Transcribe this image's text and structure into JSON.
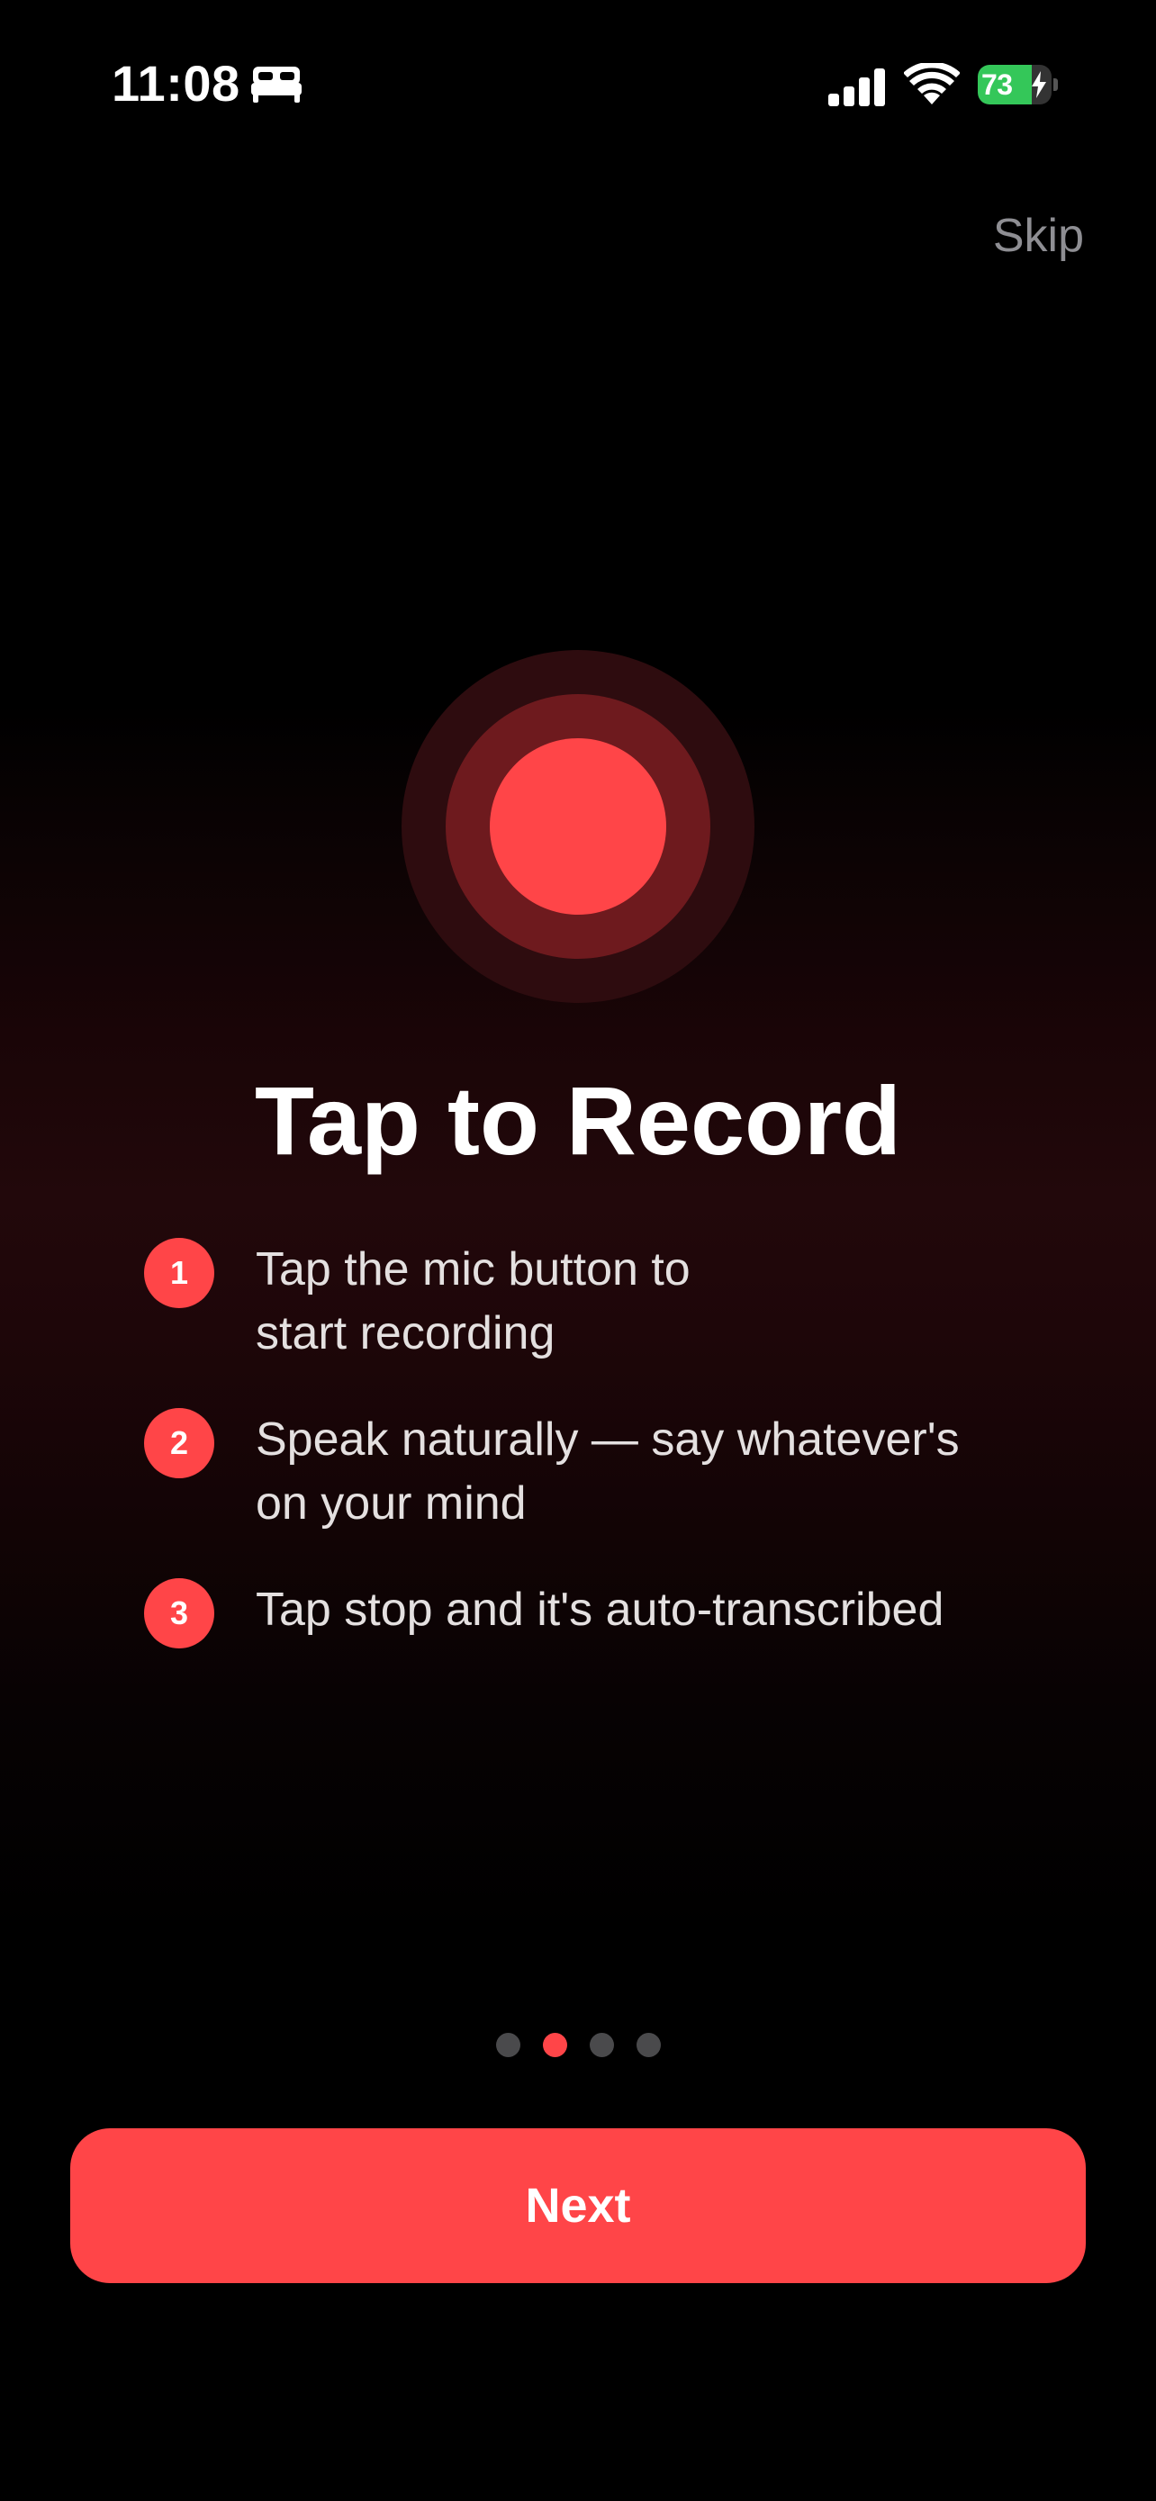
{
  "status_bar": {
    "time": "11:08",
    "battery_percent": "73",
    "battery_level": 0.73,
    "icons": [
      "bed-icon",
      "cellular-signal-icon",
      "wifi-icon",
      "battery-charging-icon"
    ]
  },
  "header": {
    "skip_label": "Skip"
  },
  "hero": {
    "icon": "record-icon",
    "title": "Tap to Record"
  },
  "steps": [
    {
      "number": "1",
      "text": "Tap the mic button to\nstart recording"
    },
    {
      "number": "2",
      "text": "Speak naturally — say whatever's\non your mind"
    },
    {
      "number": "3",
      "text": "Tap stop and it's auto-transcribed"
    }
  ],
  "pagination": {
    "total": 4,
    "current": 2
  },
  "footer": {
    "next_label": "Next"
  },
  "colors": {
    "accent": "#ff4548",
    "background": "#000000",
    "secondary_text": "#8e8e93",
    "battery_green": "#34c759"
  }
}
